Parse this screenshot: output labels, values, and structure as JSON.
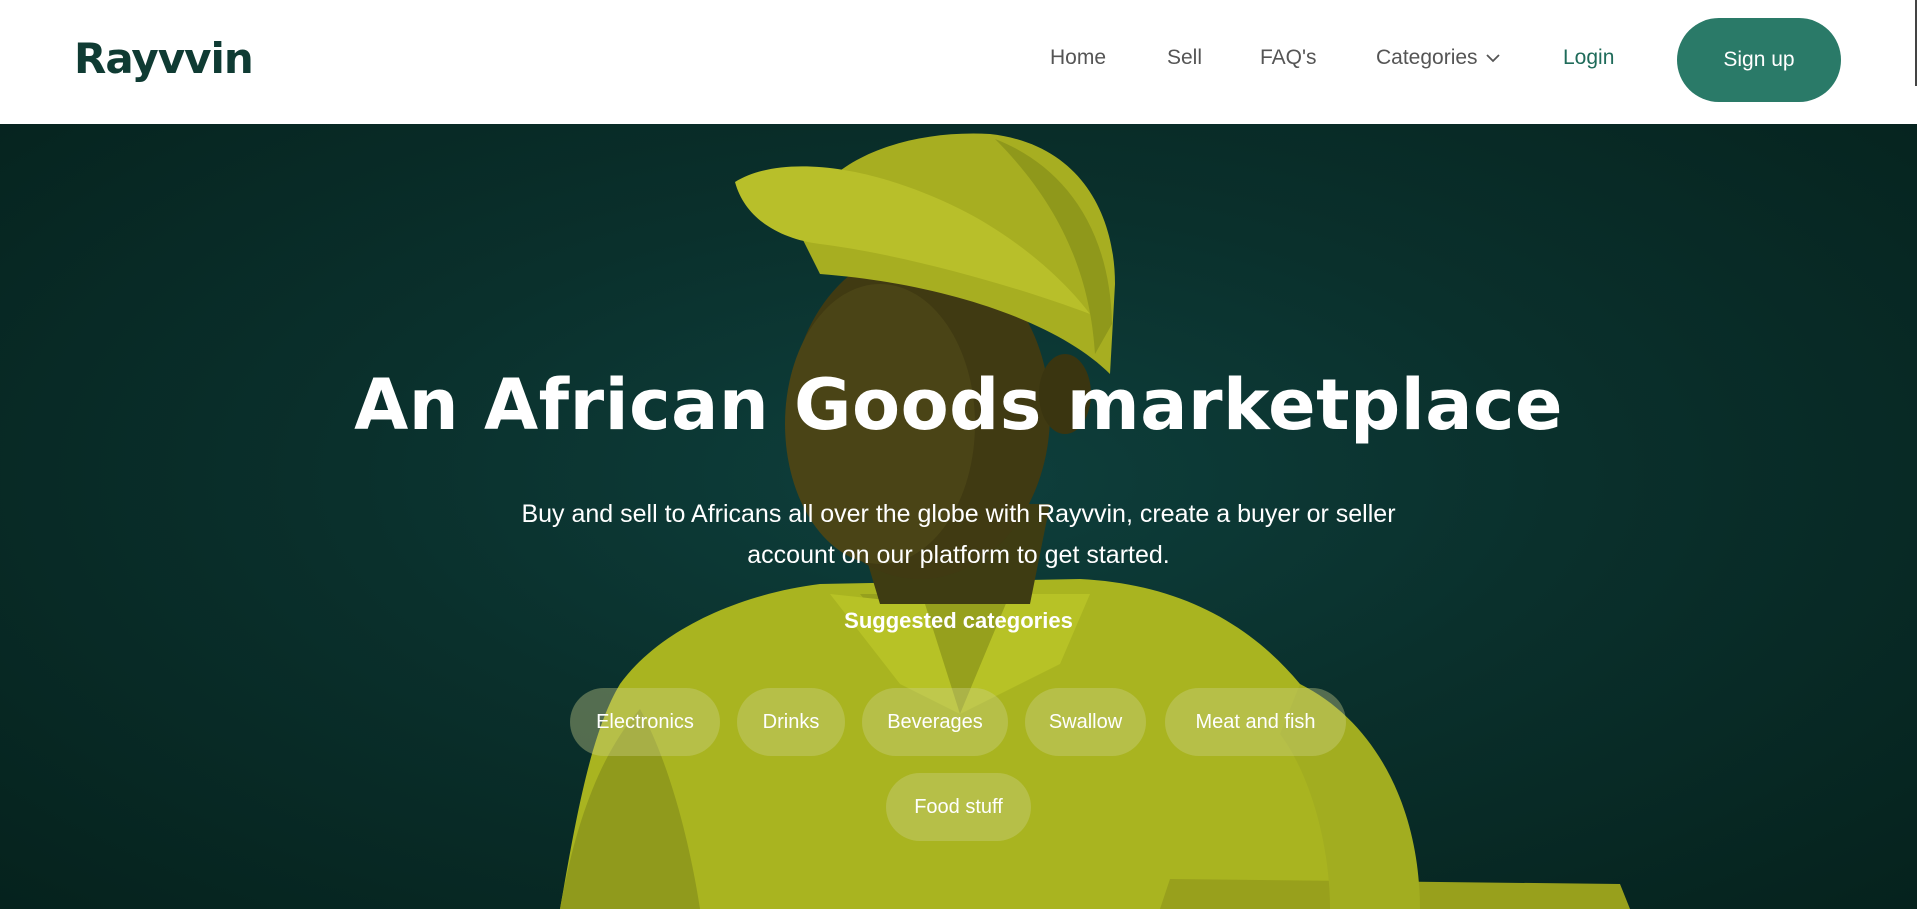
{
  "header": {
    "logo_text": "Rayvvin",
    "nav": {
      "home": "Home",
      "sell": "Sell",
      "faq": "FAQ's",
      "categories": "Categories",
      "login": "Login",
      "signup": "Sign up"
    }
  },
  "hero": {
    "title": "An African Goods marketplace",
    "subtitle": "Buy and sell to Africans all over the globe with Rayvvin, create a buyer or seller account on our platform to get started.",
    "suggested_label": "Suggested categories",
    "categories": [
      "Electronics",
      "Drinks",
      "Beverages",
      "Swallow",
      "Meat and fish",
      "Food stuff"
    ]
  },
  "colors": {
    "brand_dark": "#0f3b33",
    "brand_green": "#2a7a68",
    "hero_bg": "#0a302c",
    "figure_yellow": "#a6b21f"
  },
  "icons": {
    "categories_dropdown": "chevron-down-icon"
  }
}
